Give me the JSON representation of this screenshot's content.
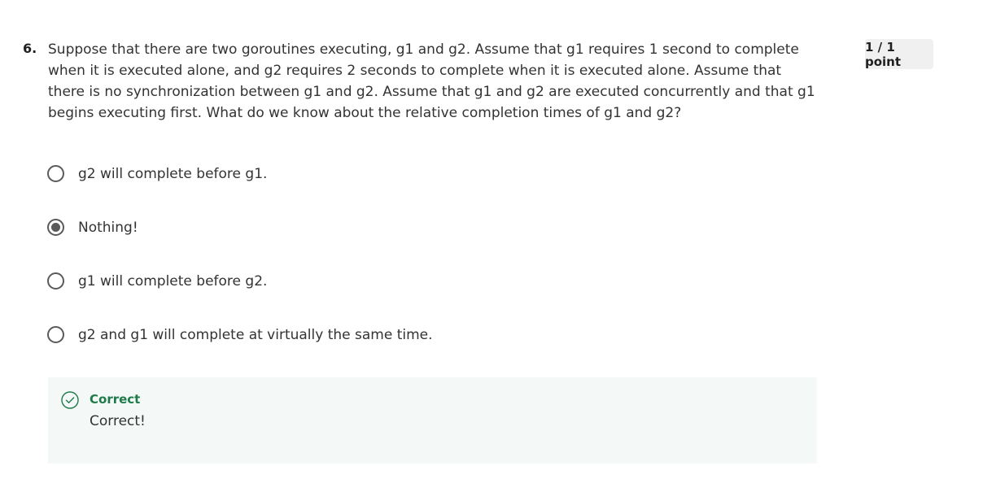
{
  "question": {
    "number": "6.",
    "text": "Suppose that there are two goroutines executing, g1 and g2. Assume that g1 requires 1 second to complete when it is executed alone, and g2 requires 2 seconds to complete when it is executed alone. Assume that there is no synchronization between g1 and g2. Assume that g1 and g2 are executed concurrently and that g1 begins executing first. What do we know about the relative completion times of g1 and g2?",
    "points": "1 / 1 point"
  },
  "options": [
    {
      "label": "g2 will complete before g1.",
      "selected": false
    },
    {
      "label": "Nothing!",
      "selected": true
    },
    {
      "label": "g1 will complete before g2.",
      "selected": false
    },
    {
      "label": "g2 and g1 will complete at virtually the same time.",
      "selected": false
    }
  ],
  "feedback": {
    "status": "Correct",
    "message": "Correct!",
    "icon": "check-circle-icon",
    "status_color": "#1f7a4a",
    "background_color": "#f4f9f7"
  },
  "colors": {
    "radio_border": "#5a5a5a",
    "badge_background": "#f0f0f0",
    "text": "#333333"
  }
}
